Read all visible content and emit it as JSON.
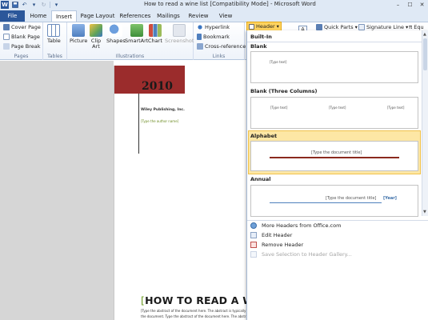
{
  "titlebar": {
    "app_icon": "W",
    "title": "How to read a wine list [Compatibility Mode] - Microsoft Word",
    "qat": [
      "save-icon",
      "undo-icon",
      "redo-icon"
    ],
    "controls": [
      "–",
      "☐",
      "✕"
    ]
  },
  "tabs": [
    {
      "label": "File"
    },
    {
      "label": "Home"
    },
    {
      "label": "Insert"
    },
    {
      "label": "Page Layout"
    },
    {
      "label": "References"
    },
    {
      "label": "Mailings"
    },
    {
      "label": "Review"
    },
    {
      "label": "View"
    }
  ],
  "ribbon": {
    "pages": {
      "items": [
        "Cover Page",
        "Blank Page",
        "Page Break"
      ],
      "group_label": "Pages"
    },
    "tables": {
      "label": "Table",
      "group_label": "Tables"
    },
    "illustrations": {
      "items": [
        "Picture",
        "Clip Art",
        "Shapes",
        "SmartArt",
        "Chart",
        "Screenshot"
      ],
      "group_label": "Illustrations"
    },
    "links": {
      "items": [
        "Hyperlink",
        "Bookmark",
        "Cross-reference"
      ],
      "group_label": "Links"
    },
    "header_btn": "Header",
    "quick_parts": "Quick Parts",
    "signature_line": "Signature Line",
    "equation_partial": "Equ"
  },
  "document": {
    "year": "2010",
    "company": "Wiley Publishing, Inc.",
    "author_placeholder": "[Type the author name]",
    "title_bracket_open": "[",
    "title": "HOW TO READ A WINE LIST",
    "title_bracket_close": "]",
    "abstract": "[Type the abstract of the document here. The abstract is typically a short summary of the contents of the document. Type the abstract of the document here. The abstract is typically a short summary of the"
  },
  "gallery": {
    "builtin_label": "Built-In",
    "blank": {
      "label": "Blank",
      "placeholder": "[Type text]"
    },
    "blank_three": {
      "label": "Blank (Three Columns)",
      "placeholders": [
        "[Type text]",
        "[Type text]",
        "[Type text]"
      ]
    },
    "alphabet": {
      "label": "Alphabet",
      "placeholder": "[Type the document title]"
    },
    "annual": {
      "label": "Annual",
      "placeholder": "[Type the document title]",
      "year": "[Year]"
    },
    "menu": [
      {
        "label": "More Headers from Office.com",
        "enabled": true,
        "icon": "office-globe-icon"
      },
      {
        "label": "Edit Header",
        "enabled": true,
        "icon": "edit-header-icon"
      },
      {
        "label": "Remove Header",
        "enabled": true,
        "icon": "remove-header-icon"
      },
      {
        "label": "Save Selection to Header Gallery...",
        "enabled": false,
        "icon": "save-selection-icon"
      }
    ]
  }
}
